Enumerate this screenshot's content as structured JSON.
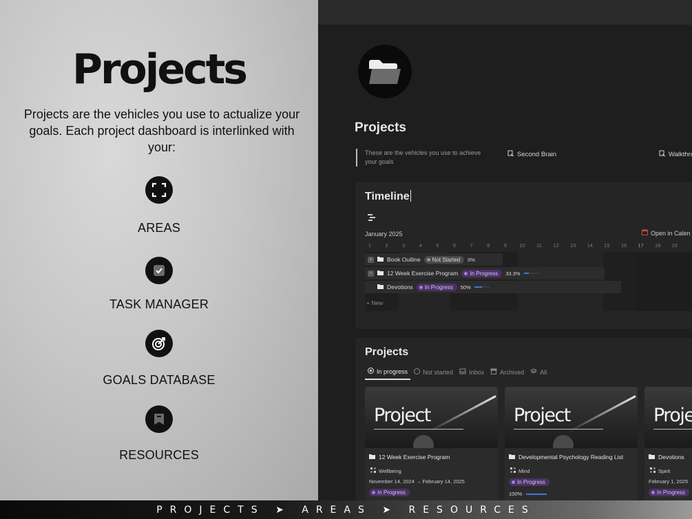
{
  "promo": {
    "title": "Projects",
    "description": "Projects are the vehicles you use to actualize your goals. Each project dashboard is interlinked with your:",
    "features": [
      {
        "label": "AREAS",
        "icon": "expand-frame-icon"
      },
      {
        "label": "TASK MANAGER",
        "icon": "checkbox-icon"
      },
      {
        "label": "GOALS DATABASE",
        "icon": "target-arrow-icon"
      },
      {
        "label": "RESOURCES",
        "icon": "bookmark-icon"
      }
    ]
  },
  "app": {
    "page_icon": "folder-icon",
    "page_title": "Projects",
    "callout": "These are the vehicles you use to achieve your goals",
    "links": [
      {
        "label": "Second Brain",
        "icon": "page-link-icon"
      },
      {
        "label": "Walkthro",
        "icon": "page-link-icon"
      }
    ],
    "timeline": {
      "title": "Timeline",
      "month": "January 2025",
      "open_calendar": "Open in Calen",
      "days": [
        "1",
        "2",
        "3",
        "4",
        "5",
        "6",
        "7",
        "8",
        "9",
        "10",
        "11",
        "12",
        "13",
        "14",
        "15",
        "16",
        "17",
        "18",
        "19"
      ],
      "rows": [
        {
          "name": "Book Outline",
          "status": "Not Started",
          "progress_label": "0%",
          "progress": 0
        },
        {
          "name": "12 Week Exercise Program",
          "status": "In Progress",
          "progress_label": "33.3%",
          "progress": 0.333
        },
        {
          "name": "Devotions",
          "status": "In Progress",
          "progress_label": "50%",
          "progress": 0.5
        }
      ],
      "new_label": "+ New"
    },
    "projects": {
      "title": "Projects",
      "tabs": [
        {
          "label": "In progress",
          "icon": "target-icon",
          "active": true
        },
        {
          "label": "Not started",
          "icon": "circle-icon",
          "active": false
        },
        {
          "label": "Inbox",
          "icon": "inbox-icon",
          "active": false
        },
        {
          "label": "Archived",
          "icon": "archive-icon",
          "active": false
        },
        {
          "label": "All",
          "icon": "layers-icon",
          "active": false
        }
      ],
      "cards": [
        {
          "cover_text": "Project",
          "name": "12 Week Exercise Program",
          "area": "Wellbeing",
          "dates": "November 14, 2024 → February 14, 2025",
          "status": "In Progress"
        },
        {
          "cover_text": "Project",
          "name": "Developmental Psychology Reading List",
          "area": "Mind",
          "status": "In Progress",
          "progress_label": "100%",
          "progress": 1.0
        },
        {
          "cover_text": "Proje",
          "name": "Devotions",
          "area": "Spirit",
          "dates": "February 1, 2025",
          "status": "In Progress"
        }
      ]
    }
  },
  "footer": {
    "breadcrumb": "PROJECTS ➤ AREAS ➤ RESOURCES"
  },
  "colors": {
    "accent_blue": "#3c7bd6",
    "status_purple": "#4b3266",
    "status_grey": "#4a4a4a"
  }
}
